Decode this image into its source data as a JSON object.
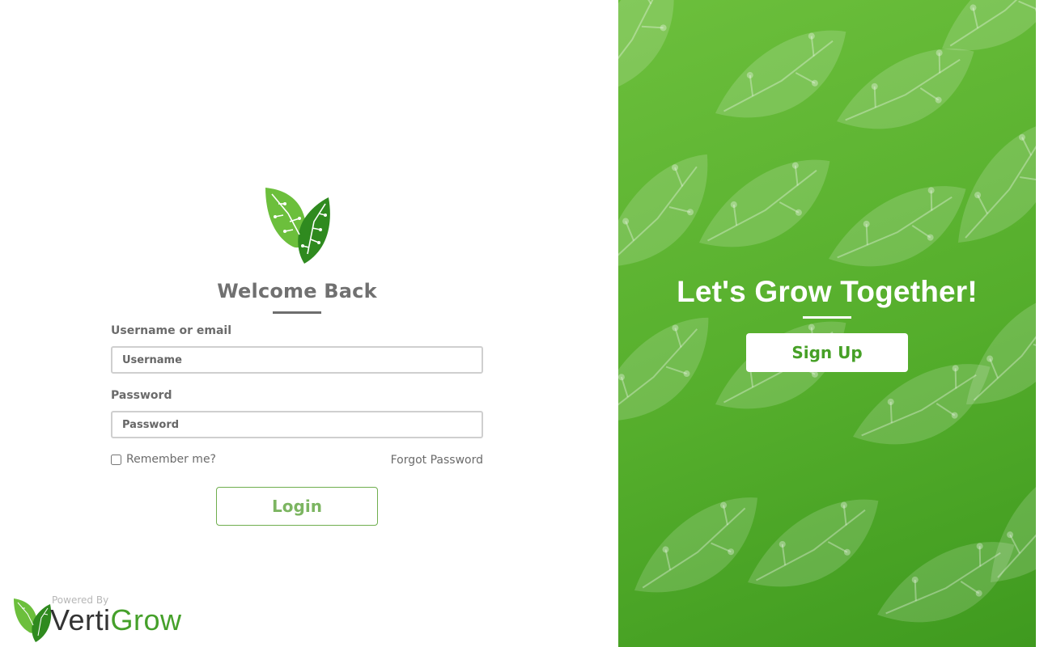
{
  "colors": {
    "brand_green": "#4ea32a",
    "light_green": "#6cbf3c",
    "login_text": "#7cb561",
    "heading_gray": "#707070"
  },
  "login": {
    "logo_icon": "leaf-circuit-logo",
    "heading": "Welcome Back",
    "username_label": "Username or email",
    "username_placeholder": "Username",
    "username_value": "",
    "password_label": "Password",
    "password_placeholder": "Password",
    "password_value": "",
    "remember_label": "Remember me?",
    "remember_checked": false,
    "forgot_label": "Forgot Password",
    "login_button": "Login"
  },
  "footer": {
    "powered_by": "Powered By",
    "brand_part1": "Verti",
    "brand_part2": "Grow",
    "logo_icon": "leaf-circuit-logo"
  },
  "signup_panel": {
    "background_icon": "leaf-circuit-pattern",
    "tagline": "Let's Grow Together!",
    "signup_button": "Sign Up"
  }
}
